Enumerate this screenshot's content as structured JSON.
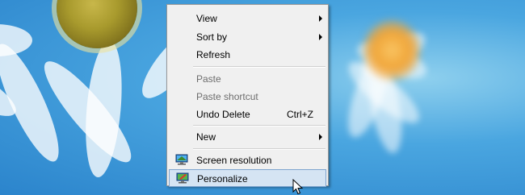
{
  "context_menu": {
    "items": [
      {
        "label": "View",
        "submenu": true,
        "disabled": false
      },
      {
        "label": "Sort by",
        "submenu": true,
        "disabled": false
      },
      {
        "label": "Refresh",
        "submenu": false,
        "disabled": false
      },
      {
        "label": "Paste",
        "submenu": false,
        "disabled": true
      },
      {
        "label": "Paste shortcut",
        "submenu": false,
        "disabled": true
      },
      {
        "label": "Undo Delete",
        "shortcut": "Ctrl+Z",
        "submenu": false,
        "disabled": false
      },
      {
        "label": "New",
        "submenu": true,
        "disabled": false
      },
      {
        "label": "Screen resolution",
        "icon": "monitor-icon",
        "submenu": false,
        "disabled": false
      },
      {
        "label": "Personalize",
        "icon": "personalize-monitor-icon",
        "submenu": false,
        "disabled": false,
        "highlighted": true
      }
    ]
  },
  "colors": {
    "menu_background": "#f0f0f0",
    "highlight_background": "#d5e4f3",
    "highlight_border": "#7ea4cf",
    "disabled_text": "#6d6d6d",
    "desktop_blue": "#3d9ddf"
  }
}
